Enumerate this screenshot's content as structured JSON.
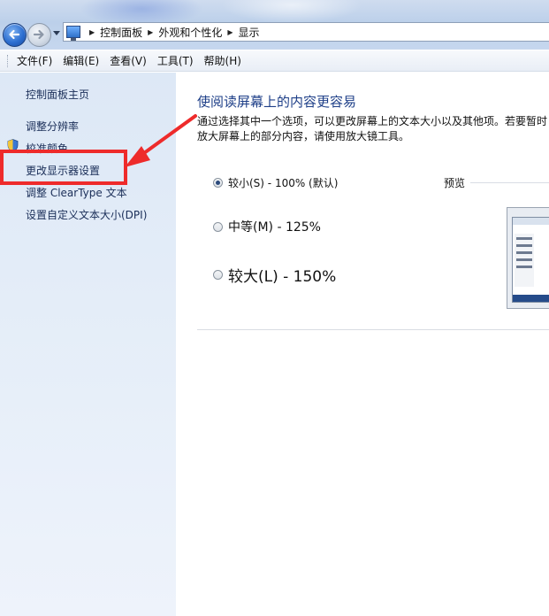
{
  "breadcrumb": {
    "items": [
      "控制面板",
      "外观和个性化",
      "显示"
    ]
  },
  "menu": {
    "items": [
      "文件(F)",
      "编辑(E)",
      "查看(V)",
      "工具(T)",
      "帮助(H)"
    ]
  },
  "sidebar": {
    "home": "控制面板主页",
    "links": [
      "调整分辨率",
      "校准颜色",
      "更改显示器设置",
      "调整 ClearType 文本",
      "设置自定义文本大小(DPI)"
    ]
  },
  "main": {
    "heading": "使阅读屏幕上的内容更容易",
    "description": "通过选择其中一个选项，可以更改屏幕上的文本大小以及其他项。若要暂时放大屏幕上的部分内容，请使用放大镜工具。",
    "options": [
      {
        "label": "较小(S) - 100% (默认)",
        "checked": true
      },
      {
        "label": "中等(M) - 125%",
        "checked": false
      },
      {
        "label": "较大(L) - 150%",
        "checked": false
      }
    ],
    "preview_label": "预览"
  },
  "annotation": {
    "color": "#ee2b2b",
    "target": "更改显示器设置"
  },
  "colors": {
    "link": "#1a2e58",
    "heading": "#1e3f88",
    "left_pane": "#dde8f6"
  }
}
